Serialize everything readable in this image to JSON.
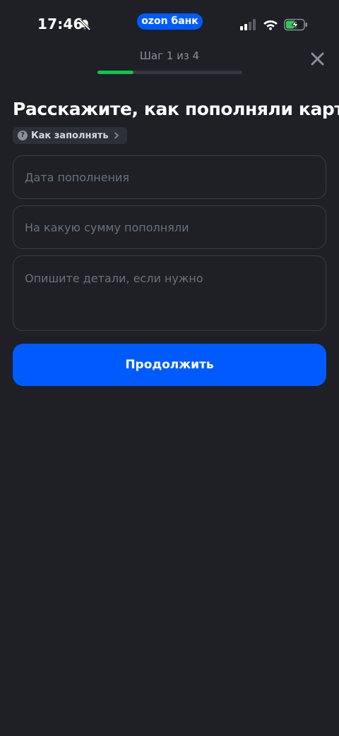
{
  "status_bar": {
    "time": "17:46",
    "app_badge": "ozon банк",
    "icons": [
      "bell-slash-icon",
      "signal-icon",
      "wifi-icon",
      "battery-charging-icon"
    ]
  },
  "header": {
    "step_label": "Шаг 1 из 4",
    "progress_fraction": 0.25,
    "close_icon": "close-icon"
  },
  "page": {
    "title": "Расскажите, как пополняли карту",
    "help_link": "Как заполнять"
  },
  "form": {
    "date_placeholder": "Дата пополнения",
    "date_value": "",
    "amount_placeholder": "На какую сумму пополняли",
    "amount_value": "",
    "details_placeholder": "Опишите детали, если нужно",
    "details_value": ""
  },
  "actions": {
    "continue_label": "Продолжить"
  },
  "colors": {
    "background": "#1e2026",
    "accent": "#005bff",
    "progress": "#10c44c"
  }
}
